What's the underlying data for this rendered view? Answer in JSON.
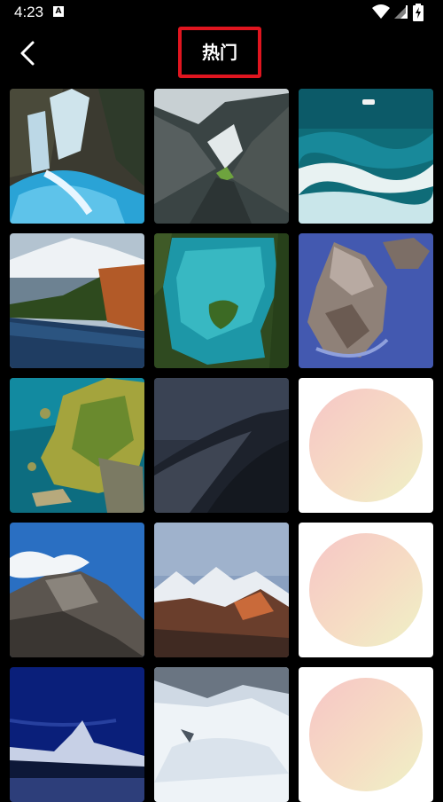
{
  "status_bar": {
    "time": "4:23",
    "notification_letter": "A",
    "icons": [
      "wifi-icon",
      "signal-icon",
      "battery-charging-icon"
    ]
  },
  "header": {
    "title": "热门",
    "back_icon": "chevron-left-icon",
    "highlight_color": "#e0151f"
  },
  "wallpapers": [
    {
      "id": "waterfall",
      "kind": "photo"
    },
    {
      "id": "mountain-valley",
      "kind": "photo"
    },
    {
      "id": "ocean-waves-aerial",
      "kind": "photo"
    },
    {
      "id": "mountain-lake-forest",
      "kind": "photo"
    },
    {
      "id": "lake-island-aerial",
      "kind": "photo"
    },
    {
      "id": "sea-rock-stack",
      "kind": "photo"
    },
    {
      "id": "coast-island-aerial",
      "kind": "photo"
    },
    {
      "id": "desert-dunes-night",
      "kind": "photo"
    },
    {
      "id": "gradient-circle-1",
      "kind": "gradient"
    },
    {
      "id": "rocky-peak-clouds",
      "kind": "photo"
    },
    {
      "id": "alpine-range",
      "kind": "photo"
    },
    {
      "id": "gradient-circle-2",
      "kind": "gradient"
    },
    {
      "id": "matterhorn-night",
      "kind": "photo"
    },
    {
      "id": "snowy-slope",
      "kind": "photo"
    },
    {
      "id": "gradient-circle-3",
      "kind": "gradient"
    }
  ]
}
